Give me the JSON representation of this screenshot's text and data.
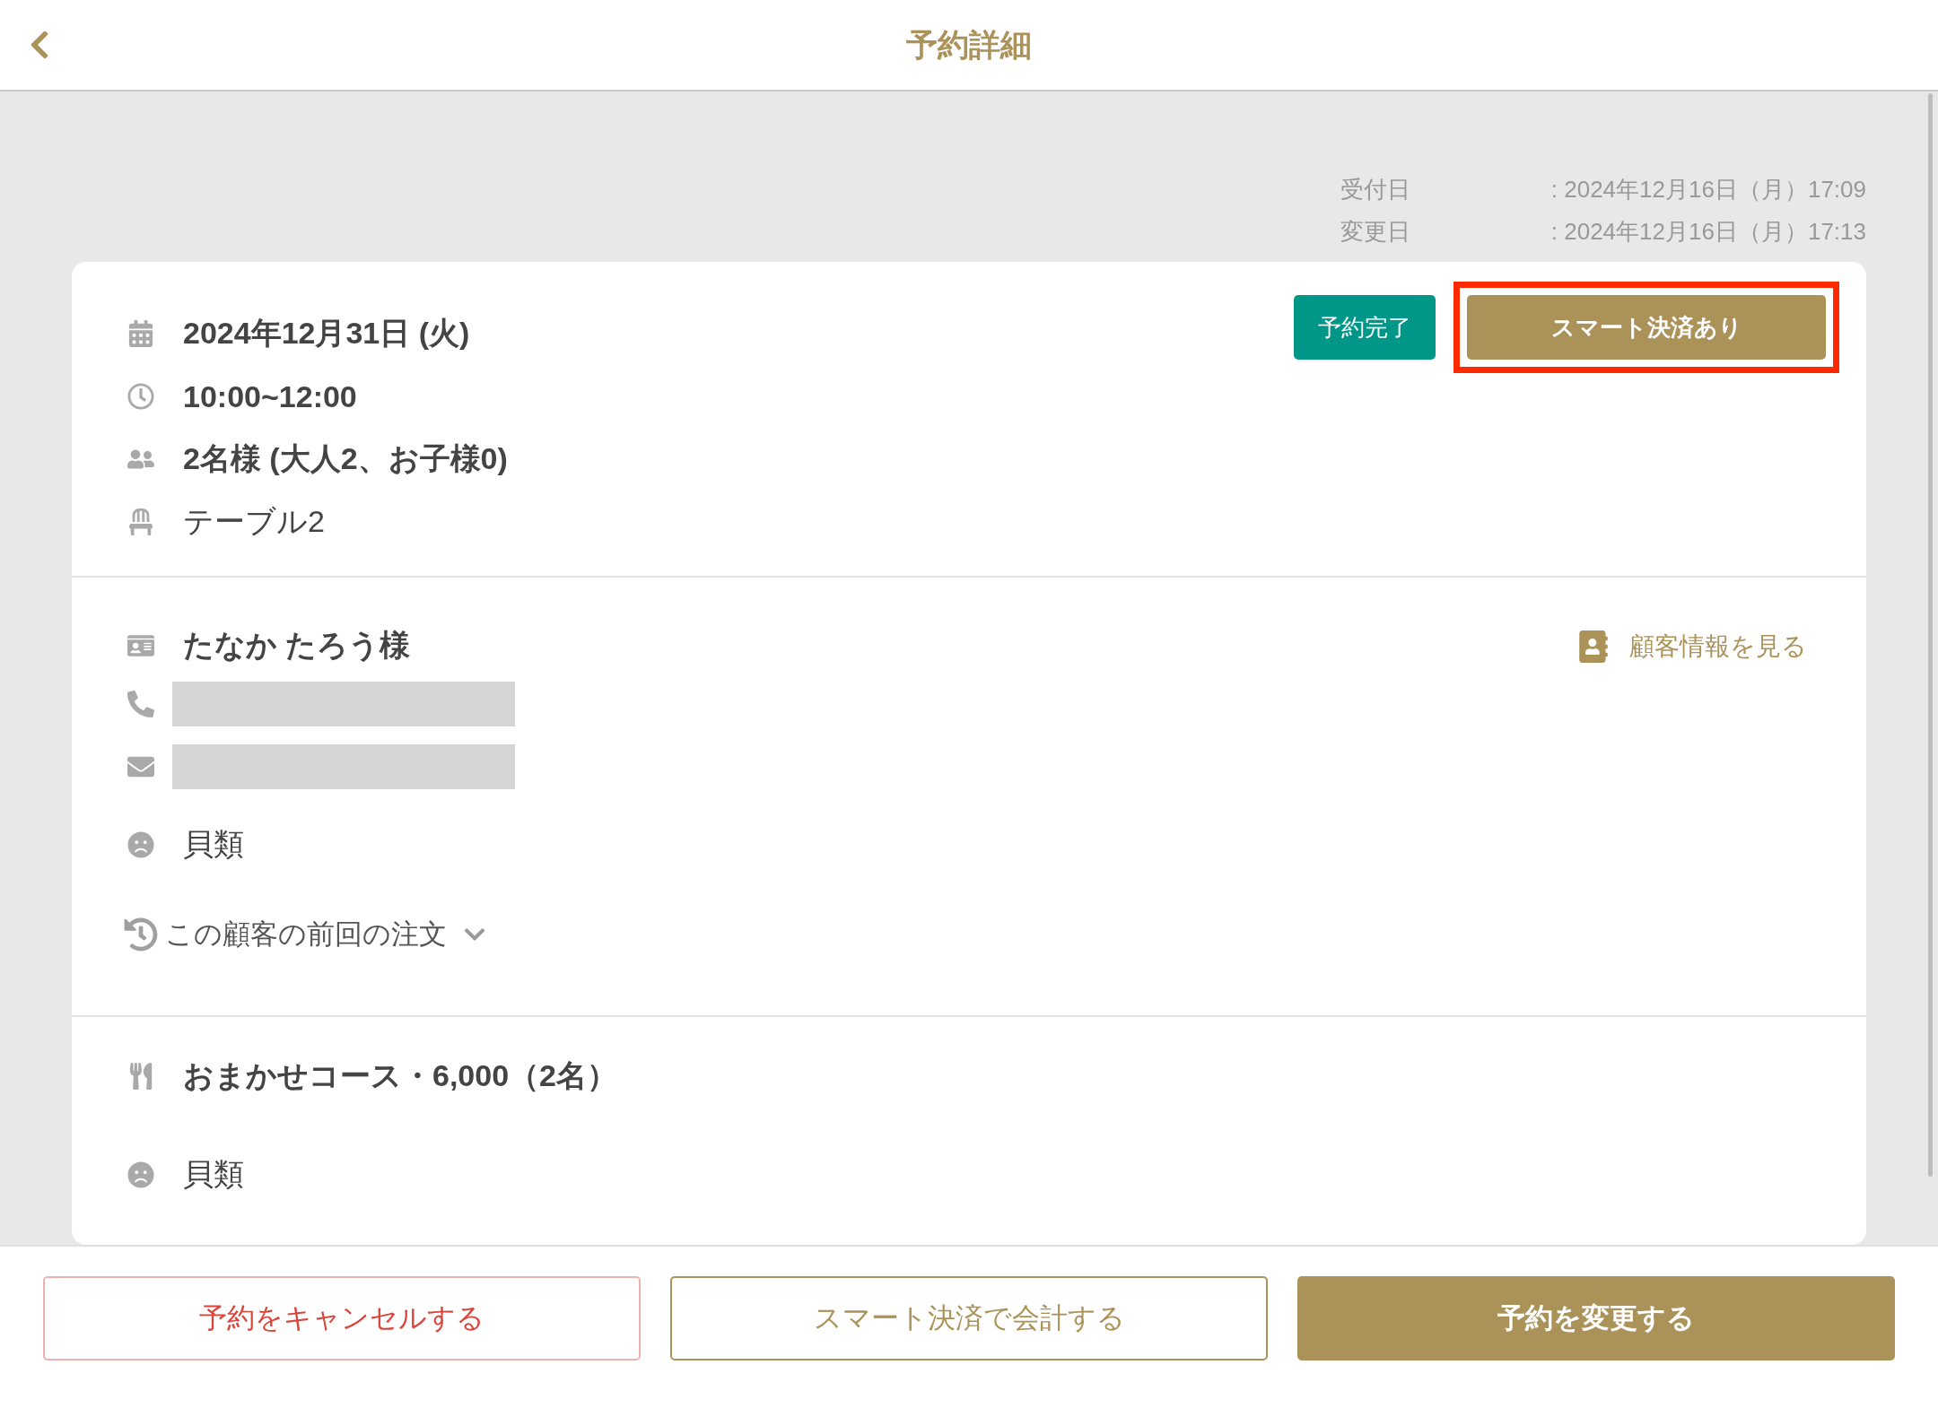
{
  "header": {
    "title": "予約詳細"
  },
  "meta": [
    {
      "label": "受付日",
      "value": ": 2024年12月16日（月）17:09"
    },
    {
      "label": "変更日",
      "value": ": 2024年12月16日（月）17:13"
    }
  ],
  "status_tags": [
    {
      "label": "予約完了",
      "kind": "status",
      "highlighted": false
    },
    {
      "label": "スマート決済あり",
      "kind": "payment",
      "highlighted": true
    }
  ],
  "reservation": [
    {
      "kind": "calendar",
      "text": "2024年12月31日 (火)",
      "bold": true
    },
    {
      "kind": "clock",
      "text": "10:00~12:00",
      "bold": true
    },
    {
      "kind": "people",
      "text": "2名様 (大人2、お子様0)",
      "bold": true
    },
    {
      "kind": "chair",
      "text": "テーブル2",
      "bold": false
    }
  ],
  "customer": {
    "name": "たなか たろう様",
    "profile_link": "顧客情報を見る",
    "contacts": [
      {
        "kind": "phone"
      },
      {
        "kind": "email"
      }
    ],
    "allergy": "貝類",
    "previous_orders": {
      "label": "この顧客の前回の注文",
      "expanded": false
    }
  },
  "course": {
    "title": "おまかせコース・6,000（2名）",
    "allergy": "貝類"
  },
  "actions": [
    {
      "label": "予約をキャンセルする",
      "kind": "danger"
    },
    {
      "label": "スマート決済で会計する",
      "kind": "outline"
    },
    {
      "label": "予約を変更する",
      "kind": "primary"
    }
  ]
}
